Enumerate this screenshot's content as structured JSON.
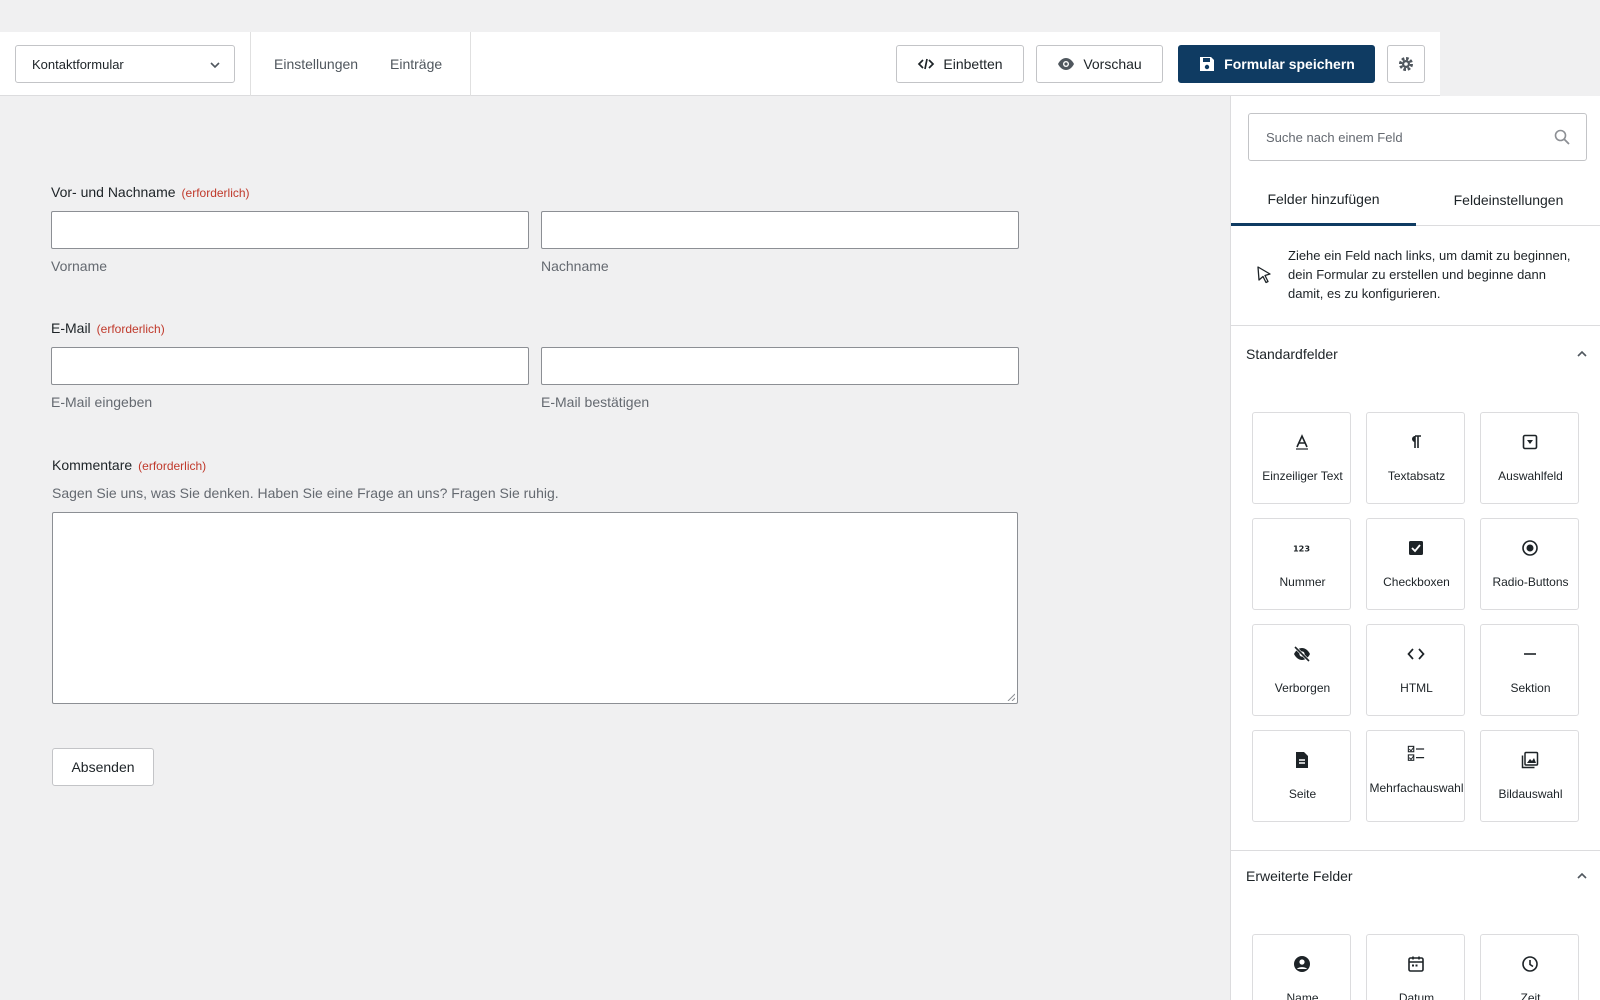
{
  "toolbar": {
    "form_selector": "Kontaktformular",
    "nav": [
      "Einstellungen",
      "Einträge"
    ],
    "embed_label": "Einbetten",
    "preview_label": "Vorschau",
    "save_label": "Formular speichern"
  },
  "form": {
    "name": {
      "label": "Vor- und Nachname",
      "required": "(erforderlich)",
      "first": "Vorname",
      "last": "Nachname"
    },
    "email": {
      "label": "E-Mail",
      "required": "(erforderlich)",
      "enter": "E-Mail eingeben",
      "confirm": "E-Mail bestätigen"
    },
    "comments": {
      "label": "Kommentare",
      "required": "(erforderlich)",
      "description": "Sagen Sie uns, was Sie denken. Haben Sie eine Frage an uns? Fragen Sie ruhig."
    },
    "submit_label": "Absenden"
  },
  "sidebar": {
    "search_placeholder": "Suche nach einem Feld",
    "tabs": [
      "Felder hinzufügen",
      "Feldeinstellungen"
    ],
    "hint": "Ziehe ein Feld nach links, um damit zu beginnen, dein Formular zu erstellen und beginne dann damit, es zu konfigurieren.",
    "standard_title": "Standardfelder",
    "standard_fields": [
      {
        "label": "Einzeiliger Text",
        "icon": "text-icon"
      },
      {
        "label": "Textabsatz",
        "icon": "paragraph-icon"
      },
      {
        "label": "Auswahlfeld",
        "icon": "dropdown-icon"
      },
      {
        "label": "Nummer",
        "icon": "number-icon"
      },
      {
        "label": "Checkboxen",
        "icon": "checkbox-icon"
      },
      {
        "label": "Radio-Buttons",
        "icon": "radio-icon"
      },
      {
        "label": "Verborgen",
        "icon": "hidden-icon"
      },
      {
        "label": "HTML",
        "icon": "code-icon"
      },
      {
        "label": "Sektion",
        "icon": "section-icon"
      },
      {
        "label": "Seite",
        "icon": "page-icon"
      },
      {
        "label": "Mehrfachauswahl",
        "icon": "multiselect-icon"
      },
      {
        "label": "Bildauswahl",
        "icon": "image-choice-icon"
      }
    ],
    "advanced_title": "Erweiterte Felder",
    "advanced_fields": [
      {
        "label": "Name",
        "icon": "user-icon"
      },
      {
        "label": "Datum",
        "icon": "calendar-icon"
      },
      {
        "label": "Zeit",
        "icon": "clock-icon"
      }
    ]
  },
  "colors": {
    "primary": "#0f3b62",
    "required": "#c0392b",
    "background": "#f0f0f1"
  }
}
